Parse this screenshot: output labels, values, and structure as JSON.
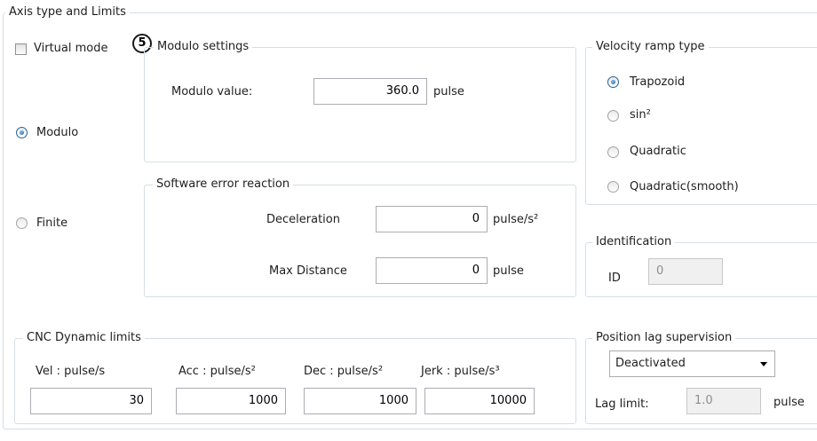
{
  "main": {
    "title": "Axis type and Limits"
  },
  "axis_type": {
    "virtual_mode": {
      "label": "Virtual mode",
      "checked": false
    },
    "modulo": {
      "label": "Modulo",
      "selected": true
    },
    "finite": {
      "label": "Finite",
      "selected": false
    },
    "callout_number": "5"
  },
  "modulo_settings": {
    "title": "Modulo settings",
    "value_label": "Modulo value:",
    "value": "360.0",
    "unit": "pulse"
  },
  "software_error": {
    "title": "Software error reaction",
    "deceleration_label": "Deceleration",
    "deceleration_value": "0",
    "deceleration_unit": "pulse/s²",
    "max_distance_label": "Max Distance",
    "max_distance_value": "0",
    "max_distance_unit": "pulse"
  },
  "velocity_ramp": {
    "title": "Velocity ramp type",
    "options": [
      {
        "label": "Trapozoid",
        "selected": true
      },
      {
        "label": "sin²",
        "selected": false
      },
      {
        "label": "Quadratic",
        "selected": false
      },
      {
        "label": "Quadratic(smooth)",
        "selected": false
      }
    ]
  },
  "identification": {
    "title": "Identification",
    "id_label": "ID",
    "id_value": "0"
  },
  "cnc_limits": {
    "title": "CNC Dynamic limits",
    "vel_label": "Vel :  pulse/s",
    "vel_value": "30",
    "acc_label": "Acc : pulse/s²",
    "acc_value": "1000",
    "dec_label": "Dec : pulse/s²",
    "dec_value": "1000",
    "jerk_label": "Jerk :  pulse/s³",
    "jerk_value": "10000"
  },
  "position_lag": {
    "title": "Position lag supervision",
    "mode_selected": "Deactivated",
    "lag_limit_label": "Lag limit:",
    "lag_limit_value": "1.0",
    "lag_limit_unit": "pulse"
  },
  "colors": {
    "group_border": "#d5dfe5",
    "radio_accent": "#1a5b9b"
  }
}
